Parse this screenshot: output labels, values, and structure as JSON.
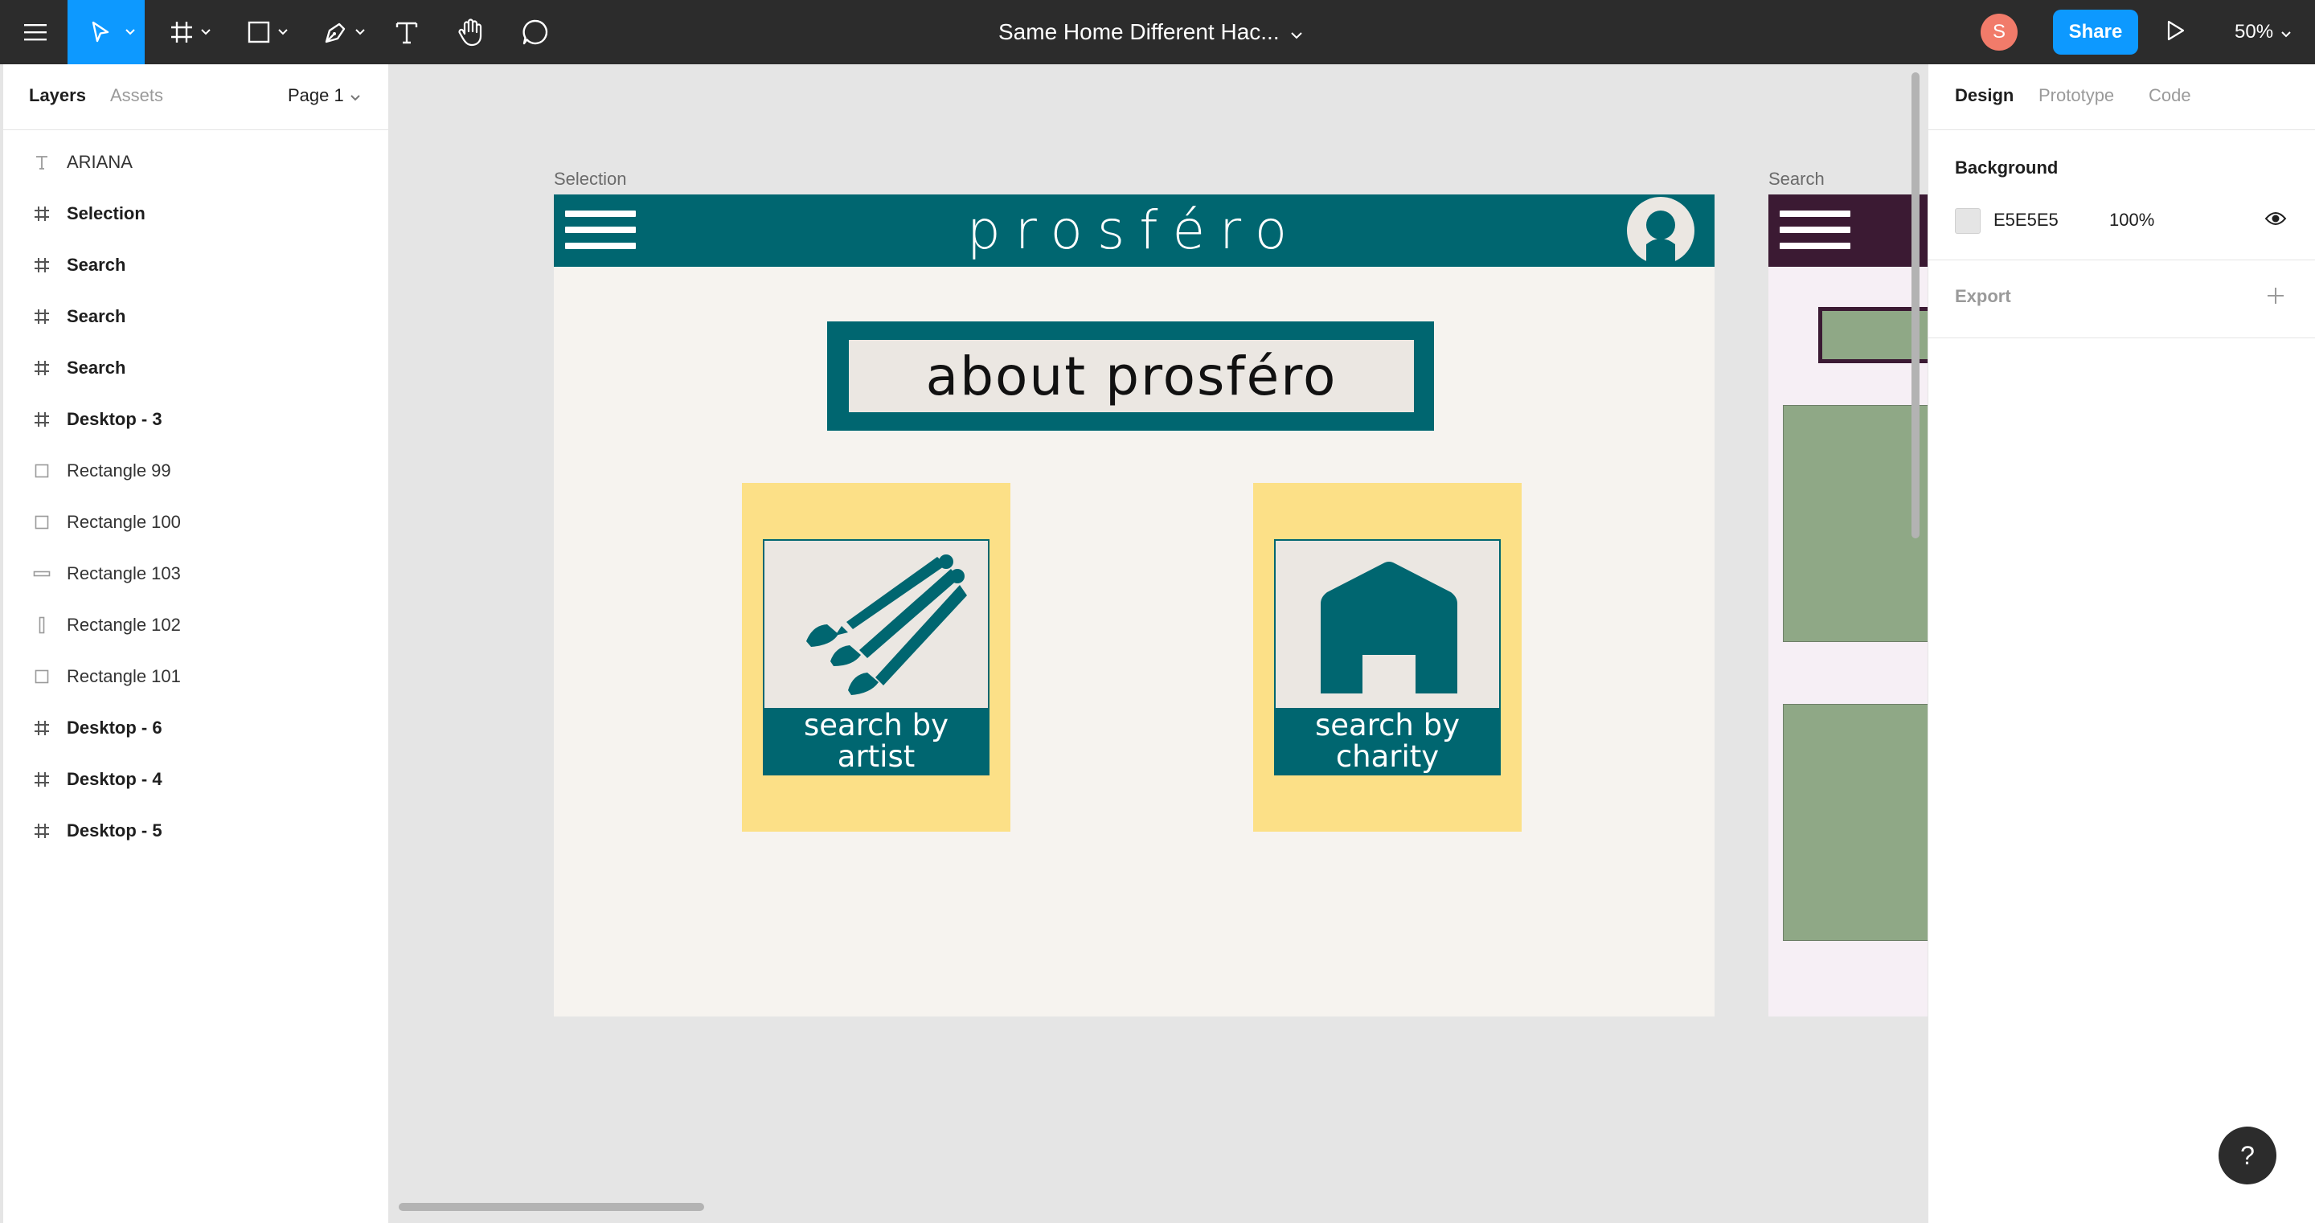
{
  "toolbar": {
    "file_title": "Same Home Different Hac...",
    "avatar_initial": "S",
    "share_label": "Share",
    "zoom_label": "50%",
    "tools": [
      "main-menu",
      "move",
      "frame",
      "shape",
      "pen",
      "text",
      "hand",
      "comment"
    ]
  },
  "left_panel": {
    "tabs": {
      "layers": "Layers",
      "assets": "Assets"
    },
    "page": "Page 1",
    "layers": [
      {
        "label": "ARIANA",
        "type": "text",
        "bold": false
      },
      {
        "label": "Selection",
        "type": "frame",
        "bold": true
      },
      {
        "label": "Search",
        "type": "frame",
        "bold": true
      },
      {
        "label": "Search",
        "type": "frame",
        "bold": true
      },
      {
        "label": "Search",
        "type": "frame",
        "bold": true
      },
      {
        "label": "Desktop - 3",
        "type": "frame",
        "bold": true
      },
      {
        "label": "Rectangle 99",
        "type": "rect",
        "bold": false
      },
      {
        "label": "Rectangle 100",
        "type": "rect",
        "bold": false
      },
      {
        "label": "Rectangle 103",
        "type": "rect-wide",
        "bold": false
      },
      {
        "label": "Rectangle 102",
        "type": "rect-tall",
        "bold": false
      },
      {
        "label": "Rectangle 101",
        "type": "rect",
        "bold": false
      },
      {
        "label": "Desktop - 6",
        "type": "frame",
        "bold": true
      },
      {
        "label": "Desktop - 4",
        "type": "frame",
        "bold": true
      },
      {
        "label": "Desktop - 5",
        "type": "frame",
        "bold": true
      }
    ]
  },
  "canvas": {
    "frame1_label": "Selection",
    "frame2_label": "Search",
    "brand": "prosféro",
    "about_text": "about prosféro",
    "card_artist": "search by artist",
    "card_charity": "search by charity",
    "colors": {
      "teal": "#006670",
      "yellow": "#fce087",
      "plum": "#3b1a33",
      "sage": "#8fa886",
      "cream": "#f6f3ef"
    }
  },
  "right_panel": {
    "tabs": {
      "design": "Design",
      "prototype": "Prototype",
      "code": "Code"
    },
    "background_title": "Background",
    "background_hex": "E5E5E5",
    "background_opacity": "100%",
    "export_title": "Export"
  },
  "help_label": "?"
}
